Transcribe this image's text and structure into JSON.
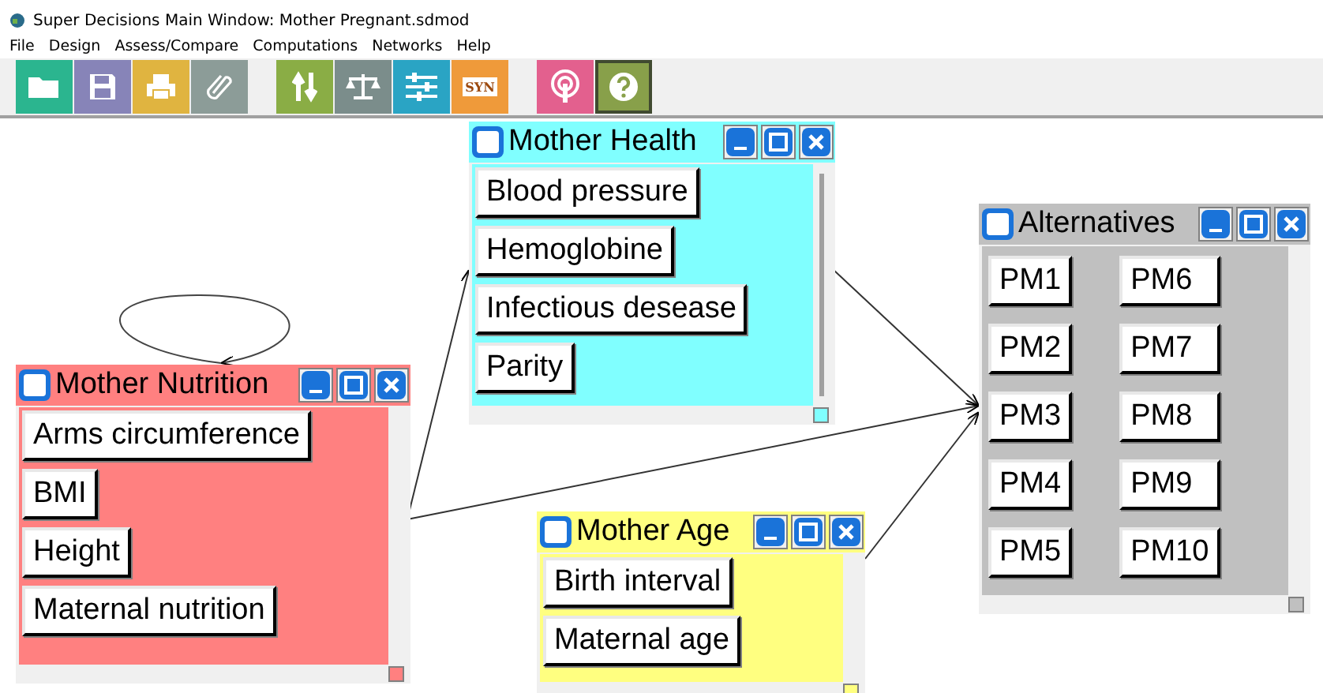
{
  "window": {
    "title": "Super Decisions Main Window: Mother Pregnant.sdmod"
  },
  "menu": [
    "File",
    "Design",
    "Assess/Compare",
    "Computations",
    "Networks",
    "Help"
  ],
  "toolbar": [
    {
      "kind": "open",
      "pressed": false
    },
    {
      "kind": "save",
      "pressed": false
    },
    {
      "kind": "print",
      "pressed": false
    },
    {
      "kind": "attach",
      "pressed": false
    },
    {
      "kind": "sync",
      "pressed": false
    },
    {
      "kind": "compare",
      "pressed": false
    },
    {
      "kind": "settings",
      "pressed": false
    },
    {
      "kind": "text",
      "label": "SYN",
      "pressed": false
    },
    {
      "kind": "broadcast",
      "pressed": false
    },
    {
      "kind": "help",
      "pressed": true
    }
  ],
  "clusters": [
    {
      "name": "Mother Health",
      "color": "#80ffff",
      "nodes": [
        "Blood pressure",
        "Hemoglobine",
        "Infectious desease",
        "Parity"
      ]
    },
    {
      "name": "Alternatives",
      "color": "#c0c0c0",
      "nodes": [
        "PM1",
        "PM2",
        "PM3",
        "PM4",
        "PM5",
        "PM6",
        "PM7",
        "PM8",
        "PM9",
        "PM10"
      ]
    },
    {
      "name": "Mother Nutrition",
      "color": "#ff8080",
      "nodes": [
        "Arms circumference",
        "BMI",
        "Height",
        "Maternal nutrition"
      ]
    },
    {
      "name": "Mother Age",
      "color": "#ffff80",
      "nodes": [
        "Birth interval",
        "Maternal age"
      ]
    }
  ]
}
